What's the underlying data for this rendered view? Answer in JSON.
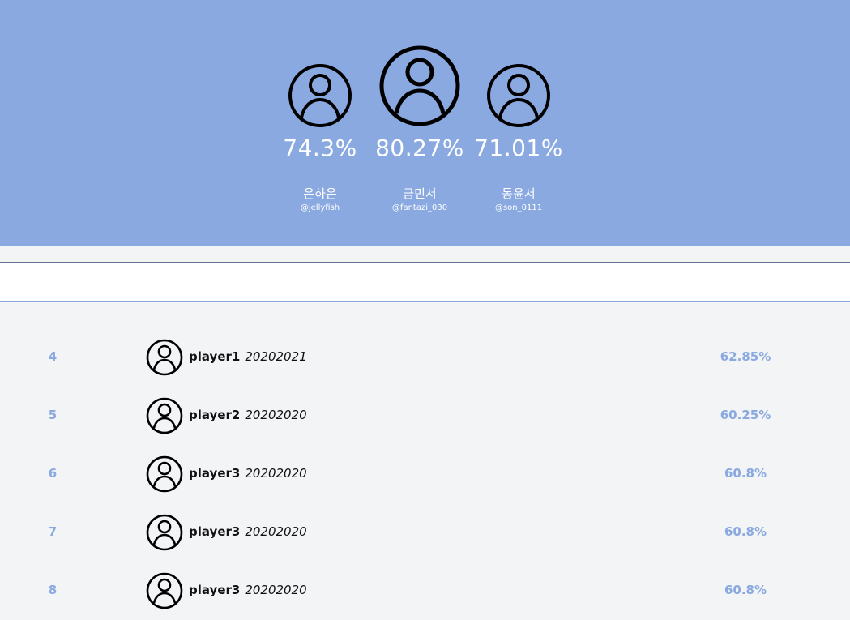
{
  "top3": [
    {
      "score": "74.3%",
      "name": "은하은",
      "handle": "@jellyfish"
    },
    {
      "score": "80.27%",
      "name": "금민서",
      "handle": "@fantazi_030"
    },
    {
      "score": "71.01%",
      "name": "동윤서",
      "handle": "@son_0111"
    }
  ],
  "rows": [
    {
      "rank": "4",
      "name": "player1",
      "date": "20202021",
      "score": "62.85%"
    },
    {
      "rank": "5",
      "name": "player2",
      "date": "20202020",
      "score": "60.25%"
    },
    {
      "rank": "6",
      "name": "player3",
      "date": "20202020",
      "score": "60.8%"
    },
    {
      "rank": "7",
      "name": "player3",
      "date": "20202020",
      "score": "60.8%"
    },
    {
      "rank": "8",
      "name": "player3",
      "date": "20202020",
      "score": "60.8%"
    }
  ],
  "colors": {
    "hero": "#8aa9e0",
    "accent": "#8aa9e0",
    "background": "#f3f4f6"
  }
}
